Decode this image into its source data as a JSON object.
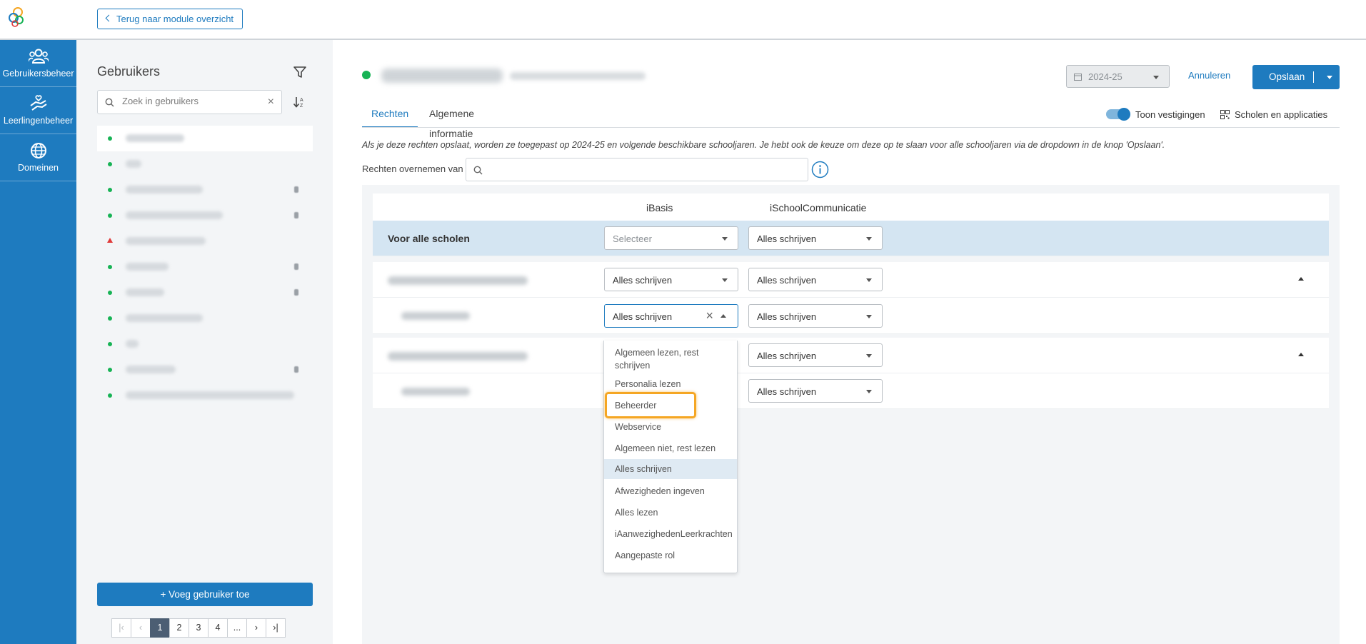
{
  "topbar": {
    "back_label": "Terug naar module overzicht"
  },
  "leftnav": {
    "items": [
      {
        "label": "Gebruikersbeheer",
        "icon": "users-icon"
      },
      {
        "label": "Leerlingenbeheer",
        "icon": "hand-heart-icon"
      },
      {
        "label": "Domeinen",
        "icon": "globe-icon"
      }
    ]
  },
  "users": {
    "title": "Gebruikers",
    "search_placeholder": "Zoek in gebruikers",
    "add_label": "Voeg gebruiker toe",
    "pagination": {
      "pages": [
        "1",
        "2",
        "3",
        "4",
        "..."
      ],
      "current": "1"
    }
  },
  "detail": {
    "year": "2024-25",
    "cancel_label": "Annuleren",
    "save_label": "Opslaan",
    "tabs": [
      {
        "label": "Rechten",
        "active": true
      },
      {
        "label": "Algemene informatie",
        "active": false
      }
    ],
    "toggle_label": "Toon vestigingen",
    "scholen_label": "Scholen en applicaties",
    "info_text": "Als je deze rechten opslaat, worden ze toegepast op 2024-25 en volgende beschikbare schooljaren. Je hebt ook de keuze om deze op te slaan voor alle schooljaren via de dropdown in de knop 'Opslaan'.",
    "copy_label": "Rechten overnemen van"
  },
  "rights": {
    "columns": [
      "iBasis",
      "iSchoolCommunicatie"
    ],
    "all_schools_label": "Voor alle scholen",
    "rows": [
      {
        "ibasis": "Selecteer",
        "isc": "Alles schrijven"
      },
      {
        "ibasis": "Alles schrijven",
        "isc": "Alles schrijven"
      },
      {
        "ibasis": "Alles schrijven",
        "isc": "Alles schrijven"
      },
      {
        "ibasis": "",
        "isc": "Alles schrijven"
      },
      {
        "ibasis": "",
        "isc": "Alles schrijven"
      }
    ],
    "dropdown_options": [
      "Algemeen lezen, rest schrijven",
      "Personalia lezen",
      "Beheerder",
      "Webservice",
      "Algemeen niet, rest lezen",
      "Alles schrijven",
      "Afwezigheden ingeven",
      "Alles lezen",
      "iAanwezighedenLeerkrachten",
      "Aangepaste rol"
    ],
    "highlighted_option": "Alles schrijven",
    "outlined_option": "Beheerder"
  },
  "colors": {
    "brand_blue": "#1e7bbf",
    "status_green": "#17b355",
    "all_schools_row": "#d4e5f2",
    "outline_orange": "#f5a623"
  }
}
